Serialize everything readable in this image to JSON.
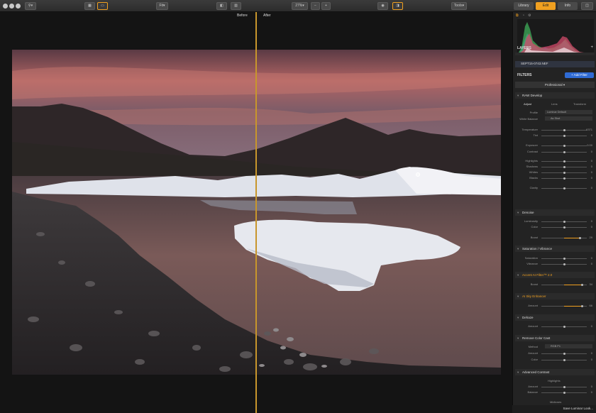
{
  "toolbar": {
    "zoom_fit_label": "Fit",
    "zoom_level": "27%",
    "zoom_minus": "−",
    "zoom_plus": "+",
    "tools_label": "Tools",
    "tabs": [
      "Library",
      "Edit",
      "Info"
    ]
  },
  "canvas": {
    "before_label": "Before",
    "after_label": "After"
  },
  "panel": {
    "layers_title": "LAYERS",
    "add_layer": "+",
    "layer_name": "SEPT15-0743.NEF",
    "filters_title": "FILTERS",
    "add_filter_label": "+ Add Filter",
    "workspace": "Professional",
    "raw_develop": {
      "title": "RAW Develop",
      "tabs": [
        "Adjust",
        "Lens",
        "Transform"
      ],
      "profile_label": "Profile",
      "profile_value": "Luminar Default",
      "wb_label": "White Balance",
      "wb_value": "As Shot"
    },
    "sliders": [
      {
        "label": "Temperature",
        "value": "6371",
        "fraction": 0.5
      },
      {
        "label": "Tint",
        "value": "0",
        "fraction": 0.5
      },
      {
        "label": "Exposure",
        "value": "0.00",
        "fraction": 0.5
      },
      {
        "label": "Contrast",
        "value": "0",
        "fraction": 0.5
      },
      {
        "label": "Highlights",
        "value": "0",
        "fraction": 0.5
      },
      {
        "label": "Shadows",
        "value": "0",
        "fraction": 0.5
      },
      {
        "label": "Whites",
        "value": "0",
        "fraction": 0.5
      },
      {
        "label": "Blacks",
        "value": "0",
        "fraction": 0.5
      },
      {
        "label": "Clarity",
        "value": "0",
        "fraction": 0.5
      }
    ],
    "denoise": {
      "title": "Denoise",
      "sliders": [
        {
          "label": "Luminosity",
          "value": "0",
          "fraction": 0.5
        },
        {
          "label": "Color",
          "value": "0",
          "fraction": 0.5
        },
        {
          "label": "Boost",
          "value": "29",
          "fraction": 0.85
        }
      ]
    },
    "saturation": {
      "title": "Saturation / Vibrance",
      "sliders": [
        {
          "label": "Saturation",
          "value": "0",
          "fraction": 0.5
        },
        {
          "label": "Vibrance",
          "value": "0",
          "fraction": 0.5
        }
      ]
    },
    "accent": {
      "title": "Accent AI Filter™ 2.0",
      "sliders": [
        {
          "label": "Boost",
          "value": "34",
          "fraction": 0.9
        }
      ]
    },
    "sky": {
      "title": "AI Sky Enhancer",
      "sliders": [
        {
          "label": "Amount",
          "value": "66",
          "fraction": 0.9
        }
      ]
    },
    "dehaze": {
      "title": "Dehaze",
      "sliders": [
        {
          "label": "Amount",
          "value": "0",
          "fraction": 0.5
        }
      ]
    },
    "colorcast": {
      "title": "Remove Color Cast",
      "method_label": "Method",
      "method_value": "RGB P1",
      "sliders": [
        {
          "label": "Amount",
          "value": "0",
          "fraction": 0.5
        },
        {
          "label": "Color",
          "value": "0",
          "fraction": 0.5
        }
      ]
    },
    "contrast": {
      "title": "Advanced Contrast",
      "highlights_label": "Highlights",
      "midtones_label": "Midtones",
      "sliders": [
        {
          "label": "Amount",
          "value": "0",
          "fraction": 0.5
        },
        {
          "label": "Balance",
          "value": "0",
          "fraction": 0.5
        },
        {
          "label": "Amount",
          "value": "0",
          "fraction": 0.5
        },
        {
          "label": "Balance",
          "value": "0",
          "fraction": 0.5
        }
      ]
    },
    "save_look": "Save Luminar Look..."
  }
}
